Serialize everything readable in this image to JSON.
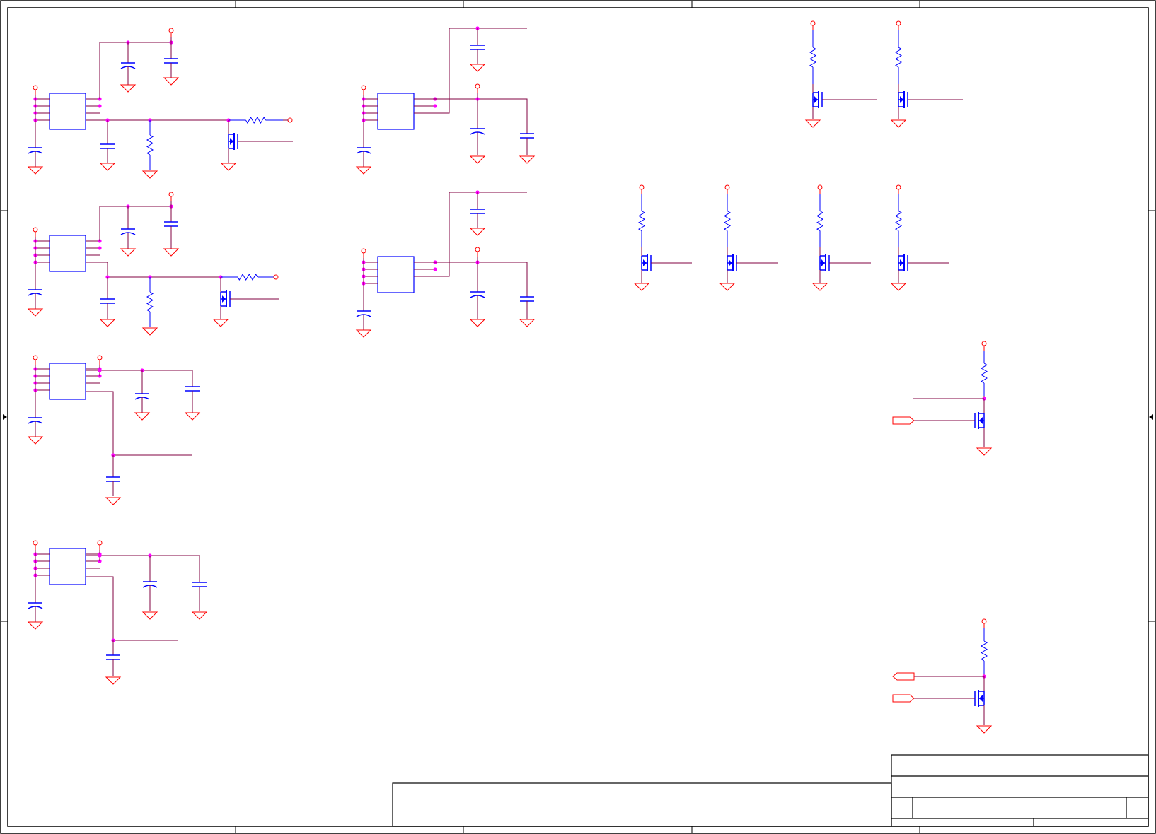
{
  "sheet": {
    "kind": "schematic",
    "labels_visible": false,
    "colors": {
      "frame": "#000000",
      "wire": "#800040",
      "power_ground": "#ff0000",
      "component": "#0000ff",
      "junction": "#ff00ff",
      "background": "#ffffff"
    }
  },
  "symbol_icons": [
    "regulator-ic",
    "capacitor",
    "polarized-capacitor",
    "resistor",
    "nmos-transistor",
    "power-port",
    "ground-symbol",
    "net-port",
    "junction-dot"
  ],
  "title_block": {
    "text": []
  }
}
